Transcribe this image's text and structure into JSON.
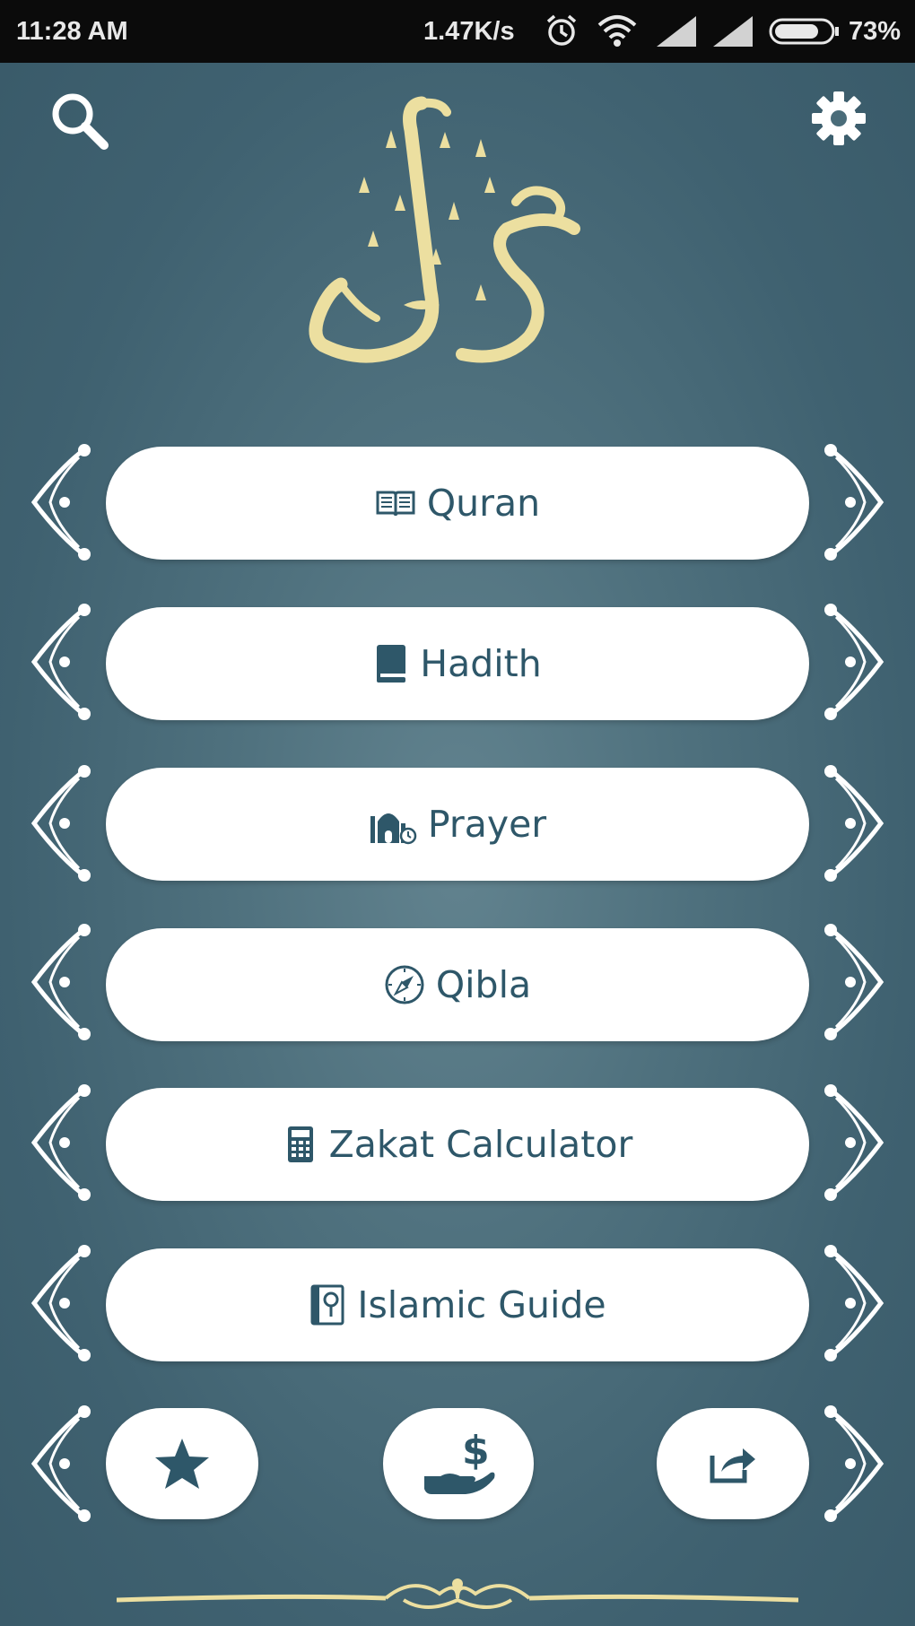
{
  "status_bar": {
    "time": "11:28 AM",
    "network_speed": "1.47K/s",
    "battery": "73%",
    "icons": [
      "alarm-icon",
      "wifi-icon",
      "signal-icon",
      "signal-icon",
      "battery-icon"
    ]
  },
  "header": {
    "search_icon": "search-icon",
    "settings_icon": "gear-icon",
    "logo_icon": "alim-calligraphy-logo"
  },
  "menu": {
    "items": [
      {
        "label": "Quran",
        "icon": "open-book-icon"
      },
      {
        "label": "Hadith",
        "icon": "book-icon"
      },
      {
        "label": "Prayer",
        "icon": "mosque-clock-icon"
      },
      {
        "label": "Qibla",
        "icon": "compass-icon"
      },
      {
        "label": "Zakat Calculator",
        "icon": "calculator-icon"
      },
      {
        "label": "Islamic Guide",
        "icon": "guide-book-icon"
      }
    ]
  },
  "bottom_actions": {
    "favorites_icon": "star-icon",
    "donate_icon": "hand-dollar-icon",
    "share_icon": "share-icon"
  },
  "colors": {
    "background": "#4f717e",
    "button_bg": "#ffffff",
    "button_text": "#2e5769",
    "logo": "#ecdfa0",
    "status_bar": "#0b0b0b"
  }
}
